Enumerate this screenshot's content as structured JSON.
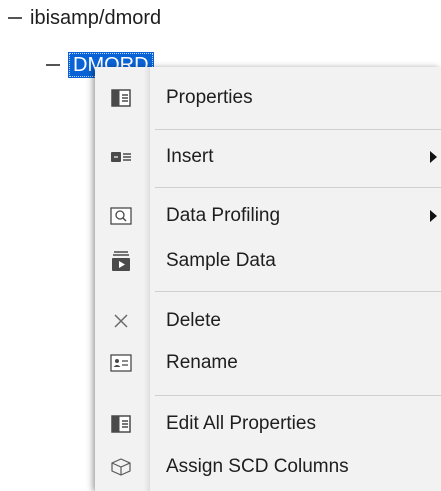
{
  "tree": {
    "root_label": "ibisamp/dmord",
    "child_label": "DMORD"
  },
  "menu": {
    "items": [
      {
        "label": "Properties",
        "icon": "properties-icon",
        "submenu": false
      },
      {
        "label": "Insert",
        "icon": "insert-icon",
        "submenu": true
      },
      {
        "label": "Data Profiling",
        "icon": "data-profiling-icon",
        "submenu": true
      },
      {
        "label": "Sample Data",
        "icon": "sample-data-icon",
        "submenu": false
      },
      {
        "label": "Delete",
        "icon": "delete-icon",
        "submenu": false
      },
      {
        "label": "Rename",
        "icon": "rename-icon",
        "submenu": false
      },
      {
        "label": "Edit All Properties",
        "icon": "edit-all-properties-icon",
        "submenu": false
      },
      {
        "label": "Assign SCD Columns",
        "icon": "assign-scd-columns-icon",
        "submenu": false
      }
    ]
  },
  "colors": {
    "selection": "#0a63d6",
    "menu_background": "#f2f2f2",
    "separator": "#cfcfcf",
    "icon": "#4a4a4a"
  }
}
